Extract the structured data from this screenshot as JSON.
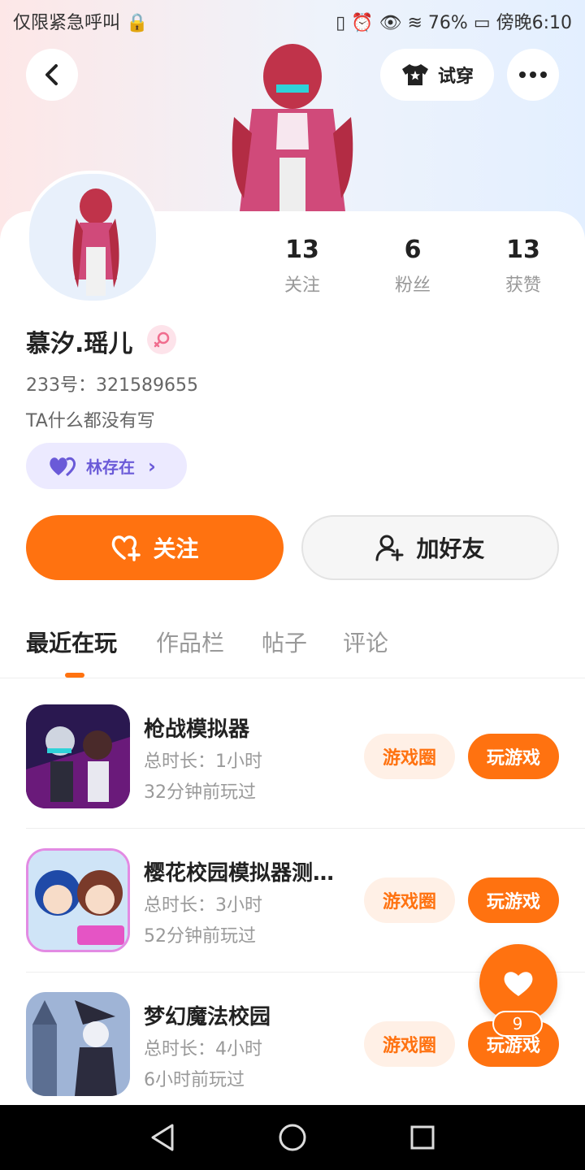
{
  "status_bar": {
    "carrier": "仅限紧急呼叫",
    "battery": "76%",
    "time": "傍晚6:10"
  },
  "header": {
    "tryon_label": "试穿"
  },
  "profile": {
    "stats": [
      {
        "value": "13",
        "label": "关注"
      },
      {
        "value": "6",
        "label": "粉丝"
      },
      {
        "value": "13",
        "label": "获赞"
      }
    ],
    "username": "慕汐.瑶儿",
    "id_text": "233号：321589655",
    "bio": "TA什么都没有写",
    "couple_name": "林存在"
  },
  "actions": {
    "follow_label": "关注",
    "add_friend_label": "加好友"
  },
  "tabs": [
    "最近在玩",
    "作品栏",
    "帖子",
    "评论"
  ],
  "games": [
    {
      "name": "枪战模拟器",
      "duration": "总时长：1小时",
      "last_played": "32分钟前玩过",
      "circle_label": "游戏圈",
      "play_label": "玩游戏"
    },
    {
      "name": "樱花校园模拟器测…",
      "duration": "总时长：3小时",
      "last_played": "52分钟前玩过",
      "circle_label": "游戏圈",
      "play_label": "玩游戏"
    },
    {
      "name": "梦幻魔法校园",
      "duration": "总时长：4小时",
      "last_played": "6小时前玩过",
      "circle_label": "游戏圈",
      "play_label": "玩游戏"
    }
  ],
  "fab": {
    "count": "9"
  },
  "colors": {
    "accent": "#ff7210",
    "accent_light": "#fff0e6",
    "couple_bg": "#eceaff"
  }
}
